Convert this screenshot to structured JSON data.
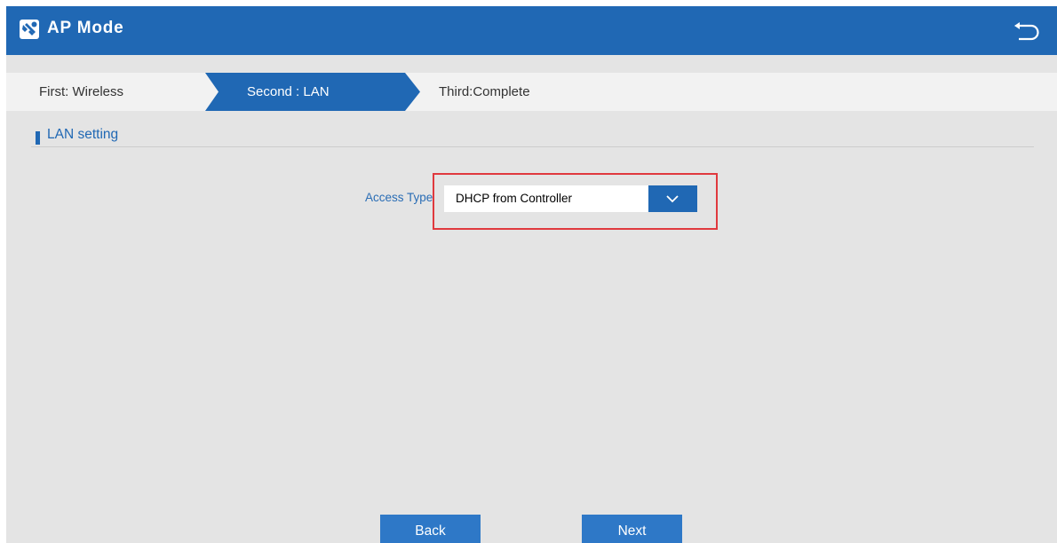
{
  "header": {
    "title": "AP Mode",
    "app_icon": "wrench-screwdriver-icon",
    "back_icon": "return-arrow-icon"
  },
  "steps": [
    {
      "label": "First: Wireless",
      "active": false
    },
    {
      "label": "Second : LAN",
      "active": true
    },
    {
      "label": "Third:Complete",
      "active": false
    }
  ],
  "section": {
    "title": "LAN setting"
  },
  "form": {
    "access_type_label": "Access Type",
    "access_type_value": "DHCP from Controller",
    "dropdown_icon": "chevron-down-icon"
  },
  "footer": {
    "back_label": "Back",
    "next_label": "Next"
  },
  "colors": {
    "brand": "#2068b4",
    "background": "#e4e4e4",
    "highlight": "#e0393e",
    "button": "#2e78c7"
  }
}
